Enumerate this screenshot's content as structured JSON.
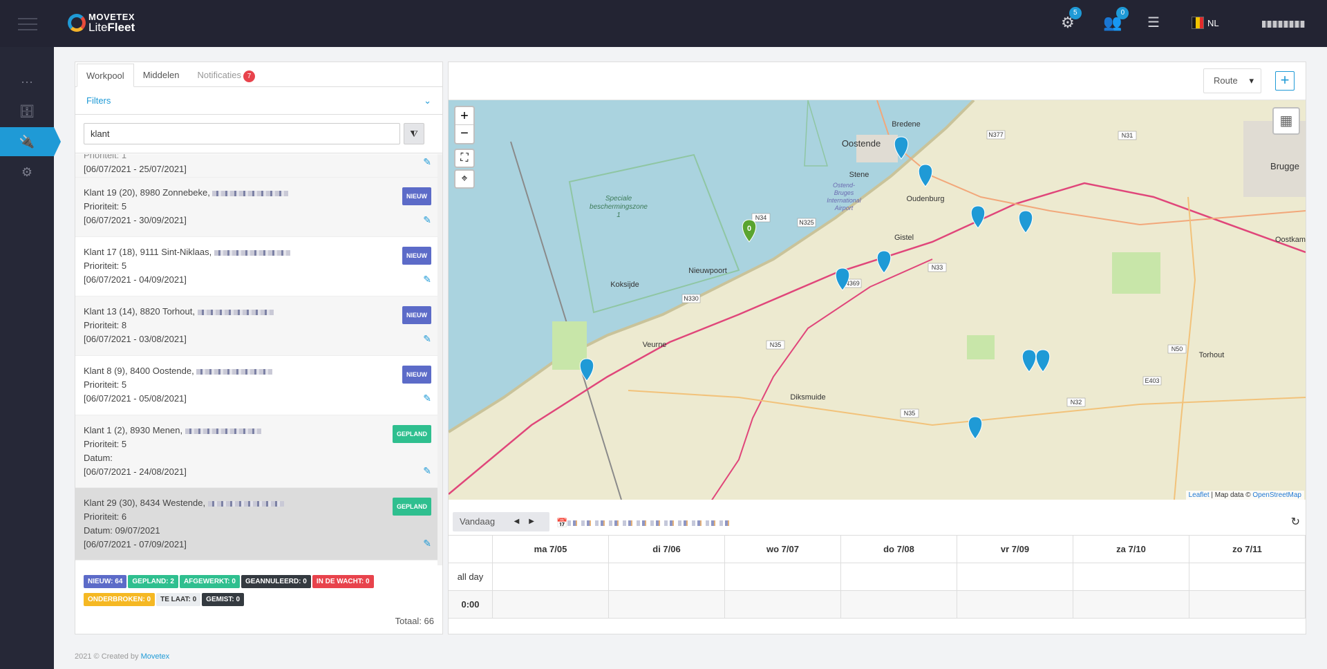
{
  "brand": {
    "top": "MOVETEX",
    "lite": "Lite",
    "fleet": "Fleet"
  },
  "topbar": {
    "settings_badge": "5",
    "users_badge": "0",
    "language": "NL",
    "flag_colors": [
      "#1a1a1a",
      "#f2c500",
      "#e32b2b"
    ]
  },
  "sidebar": {
    "items": [
      "more-icon",
      "database-icon",
      "plug-icon",
      "gear-icon"
    ],
    "active": 2
  },
  "workpool": {
    "tabs": [
      {
        "label": "Workpool"
      },
      {
        "label": "Middelen"
      },
      {
        "label": "Notificaties",
        "badge": "7"
      }
    ],
    "filters_label": "Filters",
    "search_value": "klant",
    "items": [
      {
        "title": "Klant 19 (20), 8980 Zonnebeke,",
        "prio": "Prioriteit: 5",
        "date": "",
        "range": "[06/07/2021 - 30/09/2021]",
        "status": "NIEUW"
      },
      {
        "title": "Klant 17 (18), 9111 Sint-Niklaas,",
        "prio": "Prioriteit: 5",
        "date": "",
        "range": "[06/07/2021 - 04/09/2021]",
        "status": "NIEUW"
      },
      {
        "title": "Klant 13 (14), 8820 Torhout,",
        "prio": "Prioriteit: 8",
        "date": "",
        "range": "[06/07/2021 - 03/08/2021]",
        "status": "NIEUW"
      },
      {
        "title": "Klant 8 (9), 8400 Oostende,",
        "prio": "Prioriteit: 5",
        "date": "",
        "range": "[06/07/2021 - 05/08/2021]",
        "status": "NIEUW"
      },
      {
        "title": "Klant 1 (2), 8930 Menen,",
        "prio": "Prioriteit: 5",
        "date": "Datum:",
        "range": "[06/07/2021 - 24/08/2021]",
        "status": "GEPLAND"
      },
      {
        "title": "Klant 29 (30), 8434 Westende,",
        "prio": "Prioriteit: 6",
        "date": "Datum: 09/07/2021",
        "range": "[06/07/2021 - 07/09/2021]",
        "status": "GEPLAND"
      }
    ],
    "partial_item": {
      "prio": "Prioriteit: 1",
      "range": "[06/07/2021 - 25/07/2021]"
    },
    "status_pills": [
      {
        "label": "NIEUW: 64",
        "color": "#5c6bc8"
      },
      {
        "label": "GEPLAND: 2",
        "color": "#2fbf8f"
      },
      {
        "label": "AFGEWERKT: 0",
        "color": "#2fbf8f"
      },
      {
        "label": "GEANNULEERD: 0",
        "color": "#343a40"
      },
      {
        "label": "IN DE WACHT: 0",
        "color": "#e8434c"
      },
      {
        "label": "ONDERBROKEN: 0",
        "color": "#f5b823"
      },
      {
        "label": "TE LAAT: 0",
        "color": "#e9ecef"
      },
      {
        "label": "GEMIST: 0",
        "color": "#343a40"
      }
    ],
    "total": "Totaal: 66"
  },
  "map": {
    "route_label": "Route",
    "zone_label_1": "Speciale",
    "zone_label_2": "beschermingszone",
    "zone_label_3": "1",
    "airport": [
      "Ostend-",
      "Bruges",
      "International",
      "Airport"
    ],
    "places": [
      "Oostende",
      "Bredene",
      "Stene",
      "Oudenburg",
      "Gistel",
      "Nieuwpoort",
      "Koksijde",
      "Veurne",
      "Diksmuide",
      "Torhout",
      "Brugge",
      "Oostkam"
    ],
    "roads": [
      "N377",
      "N31",
      "N325",
      "N369",
      "N33",
      "N330",
      "N35",
      "N35",
      "N32",
      "N50",
      "E403",
      "N34"
    ],
    "green_marker_label": "0",
    "attribution_leaflet": "Leaflet",
    "attribution_text": " | Map data © ",
    "attribution_osm": "OpenStreetMap"
  },
  "calendar": {
    "today": "Vandaag",
    "days": [
      "ma 7/05",
      "di 7/06",
      "wo 7/07",
      "do 7/08",
      "vr 7/09",
      "za 7/10",
      "zo 7/11"
    ],
    "all_day": "all day",
    "time_0": "0:00"
  },
  "footer": {
    "text": "2021 © Created by ",
    "link": "Movetex"
  }
}
